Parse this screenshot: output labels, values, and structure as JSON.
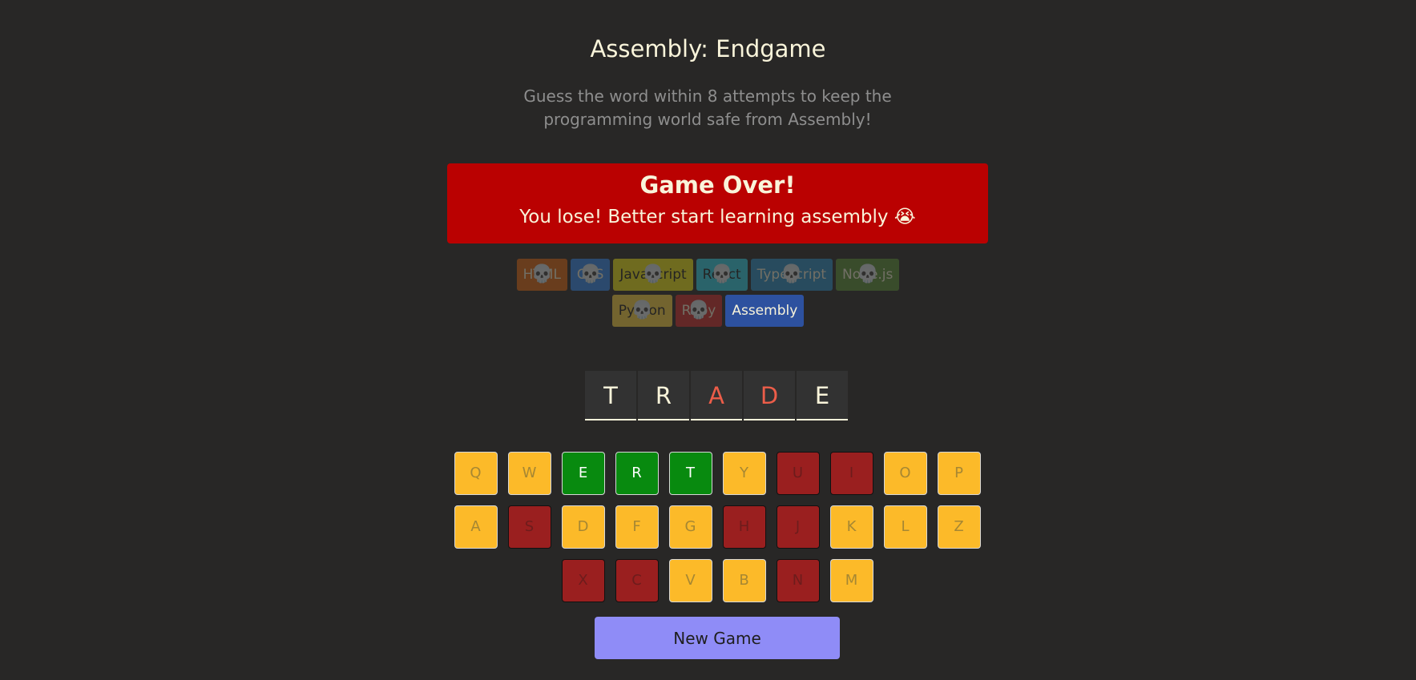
{
  "header": {
    "title": "Assembly: Endgame",
    "subtitle": "Guess the word within 8 attempts to keep the programming world safe from Assembly!"
  },
  "status": {
    "heading": "Game Over!",
    "message": "You lose! Better start learning assembly 😭",
    "color": "#ba0101"
  },
  "languages": [
    {
      "name": "HTML",
      "bg": "#e2680f",
      "fg": "#f9f4da",
      "lost": true
    },
    {
      "name": "CSS",
      "bg": "#328af1",
      "fg": "#f9f4da",
      "lost": true
    },
    {
      "name": "Javascript",
      "bg": "#f4eb13",
      "fg": "#1e1e1e",
      "lost": true
    },
    {
      "name": "React",
      "bg": "#2ed3e9",
      "fg": "#1e1e1e",
      "lost": true
    },
    {
      "name": "Typescript",
      "bg": "#298ec6",
      "fg": "#f9f4da",
      "lost": true
    },
    {
      "name": "Node.js",
      "bg": "#599137",
      "fg": "#f9f4da",
      "lost": true
    },
    {
      "name": "Python",
      "bg": "#ffd742",
      "fg": "#1e1e1e",
      "lost": true
    },
    {
      "name": "Ruby",
      "bg": "#d02b2b",
      "fg": "#f9f4da",
      "lost": true
    },
    {
      "name": "Assembly",
      "bg": "#2d519f",
      "fg": "#f9f4da",
      "lost": false
    }
  ],
  "skull_icon": "💀",
  "word": [
    {
      "char": "T",
      "missed": false
    },
    {
      "char": "R",
      "missed": false
    },
    {
      "char": "A",
      "missed": true
    },
    {
      "char": "D",
      "missed": true
    },
    {
      "char": "E",
      "missed": false
    }
  ],
  "keyboard": {
    "rows": [
      [
        {
          "key": "Q",
          "state": "unused"
        },
        {
          "key": "W",
          "state": "unused"
        },
        {
          "key": "E",
          "state": "correct"
        },
        {
          "key": "R",
          "state": "correct"
        },
        {
          "key": "T",
          "state": "correct"
        },
        {
          "key": "Y",
          "state": "unused"
        },
        {
          "key": "U",
          "state": "wrong"
        },
        {
          "key": "I",
          "state": "wrong"
        },
        {
          "key": "O",
          "state": "unused"
        },
        {
          "key": "P",
          "state": "unused"
        }
      ],
      [
        {
          "key": "A",
          "state": "unused"
        },
        {
          "key": "S",
          "state": "wrong"
        },
        {
          "key": "D",
          "state": "unused"
        },
        {
          "key": "F",
          "state": "unused"
        },
        {
          "key": "G",
          "state": "unused"
        },
        {
          "key": "H",
          "state": "wrong"
        },
        {
          "key": "J",
          "state": "wrong"
        },
        {
          "key": "K",
          "state": "unused"
        },
        {
          "key": "L",
          "state": "unused"
        },
        {
          "key": "Z",
          "state": "unused"
        }
      ],
      [
        {
          "key": "X",
          "state": "wrong"
        },
        {
          "key": "C",
          "state": "wrong"
        },
        {
          "key": "V",
          "state": "unused"
        },
        {
          "key": "B",
          "state": "unused"
        },
        {
          "key": "N",
          "state": "wrong"
        },
        {
          "key": "M",
          "state": "unused"
        }
      ]
    ]
  },
  "new_game_label": "New Game"
}
